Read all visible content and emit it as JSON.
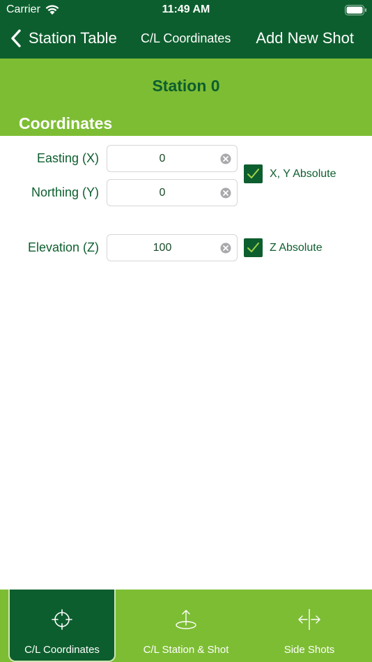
{
  "status_bar": {
    "carrier": "Carrier",
    "time": "11:49 AM"
  },
  "nav": {
    "back_label": "Station Table",
    "title": "C/L Coordinates",
    "action_label": "Add New Shot"
  },
  "header": {
    "station_title": "Station 0",
    "section_title": "Coordinates"
  },
  "fields": {
    "easting": {
      "label": "Easting (X)",
      "value": "0"
    },
    "northing": {
      "label": "Northing (Y)",
      "value": "0"
    },
    "elevation": {
      "label": "Elevation (Z)",
      "value": "100"
    }
  },
  "checks": {
    "xy": {
      "label": "X, Y Absolute",
      "checked": true
    },
    "z": {
      "label": "Z Absolute",
      "checked": true
    }
  },
  "tabs": [
    {
      "label": "C/L Coordinates",
      "icon": "crosshair-icon",
      "active": true
    },
    {
      "label": "C/L Station & Shot",
      "icon": "station-up-arrow-icon",
      "active": false
    },
    {
      "label": "Side Shots",
      "icon": "split-arrows-icon",
      "active": false
    }
  ],
  "colors": {
    "dark_green": "#0d5e2e",
    "light_green": "#7dbd34",
    "white": "#ffffff"
  }
}
